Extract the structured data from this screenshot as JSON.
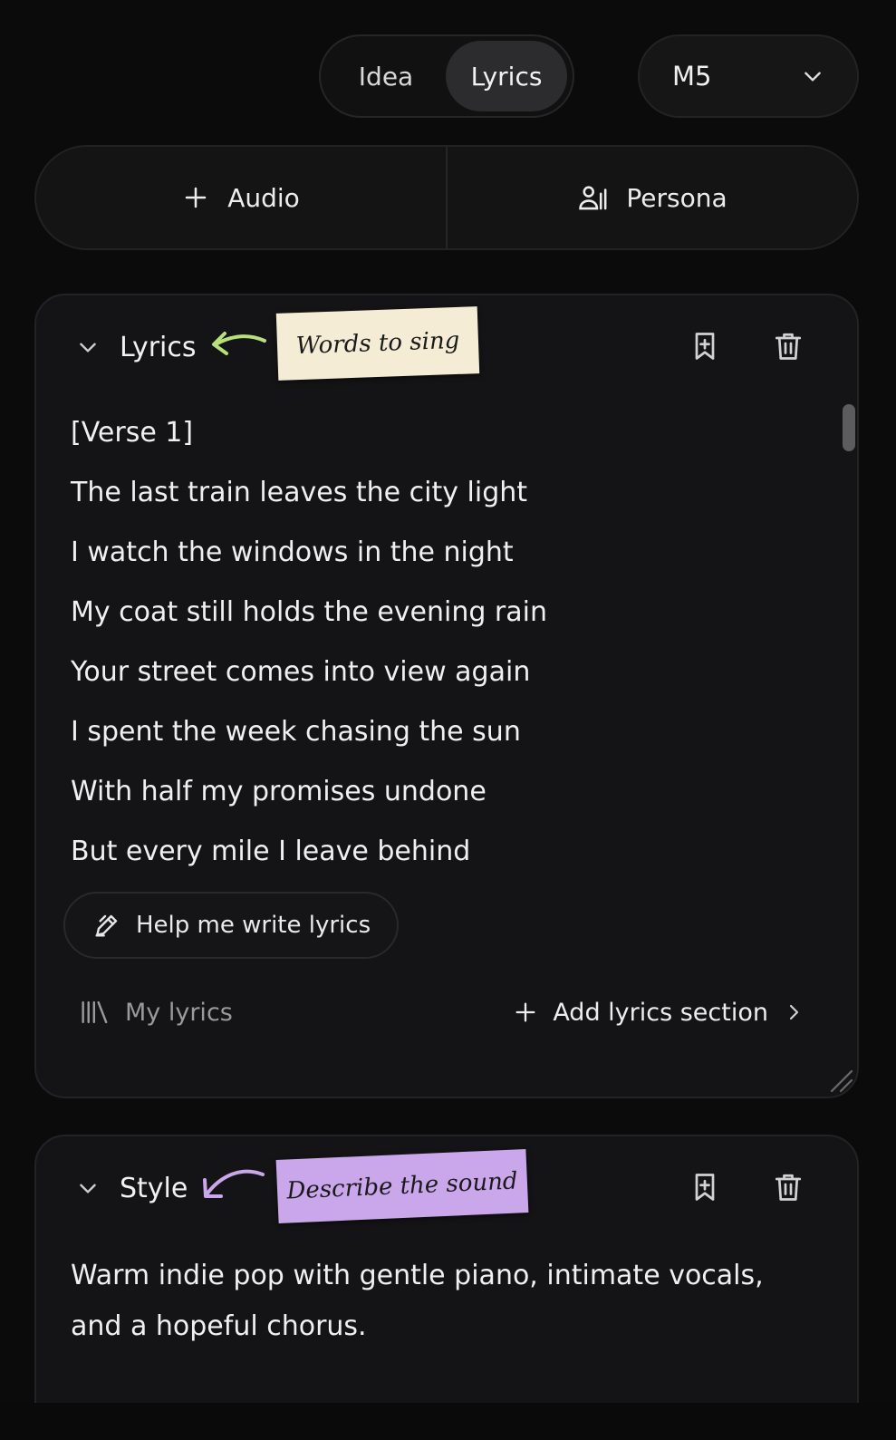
{
  "mode_toggle": {
    "idea_label": "Idea",
    "lyrics_label": "Lyrics",
    "active": "Lyrics"
  },
  "model_select": {
    "value": "M5"
  },
  "add_buttons": {
    "audio_label": "Audio",
    "persona_label": "Persona"
  },
  "lyrics_card": {
    "title": "Lyrics",
    "note": "Words to sing",
    "lines": [
      "[Verse 1]",
      "The last train leaves the city light",
      "I watch the windows in the night",
      "My coat still holds the evening rain",
      "Your street comes into view again",
      "I spent the week chasing the sun",
      "With half my promises undone",
      "But every mile I leave behind"
    ],
    "help_button": "Help me write lyrics",
    "my_lyrics": "My lyrics",
    "add_section": "Add lyrics section"
  },
  "style_card": {
    "title": "Style",
    "note": "Describe the sound",
    "text": "Warm indie pop with gentle piano, intimate vocals, and a hopeful chorus."
  },
  "colors": {
    "background": "#0b0b0c",
    "card": "#141416",
    "note_cream": "#f4ecd4",
    "note_purple": "#c9a7ea",
    "arrow_green": "#b8e07a",
    "arrow_purple": "#c9a7ea"
  }
}
